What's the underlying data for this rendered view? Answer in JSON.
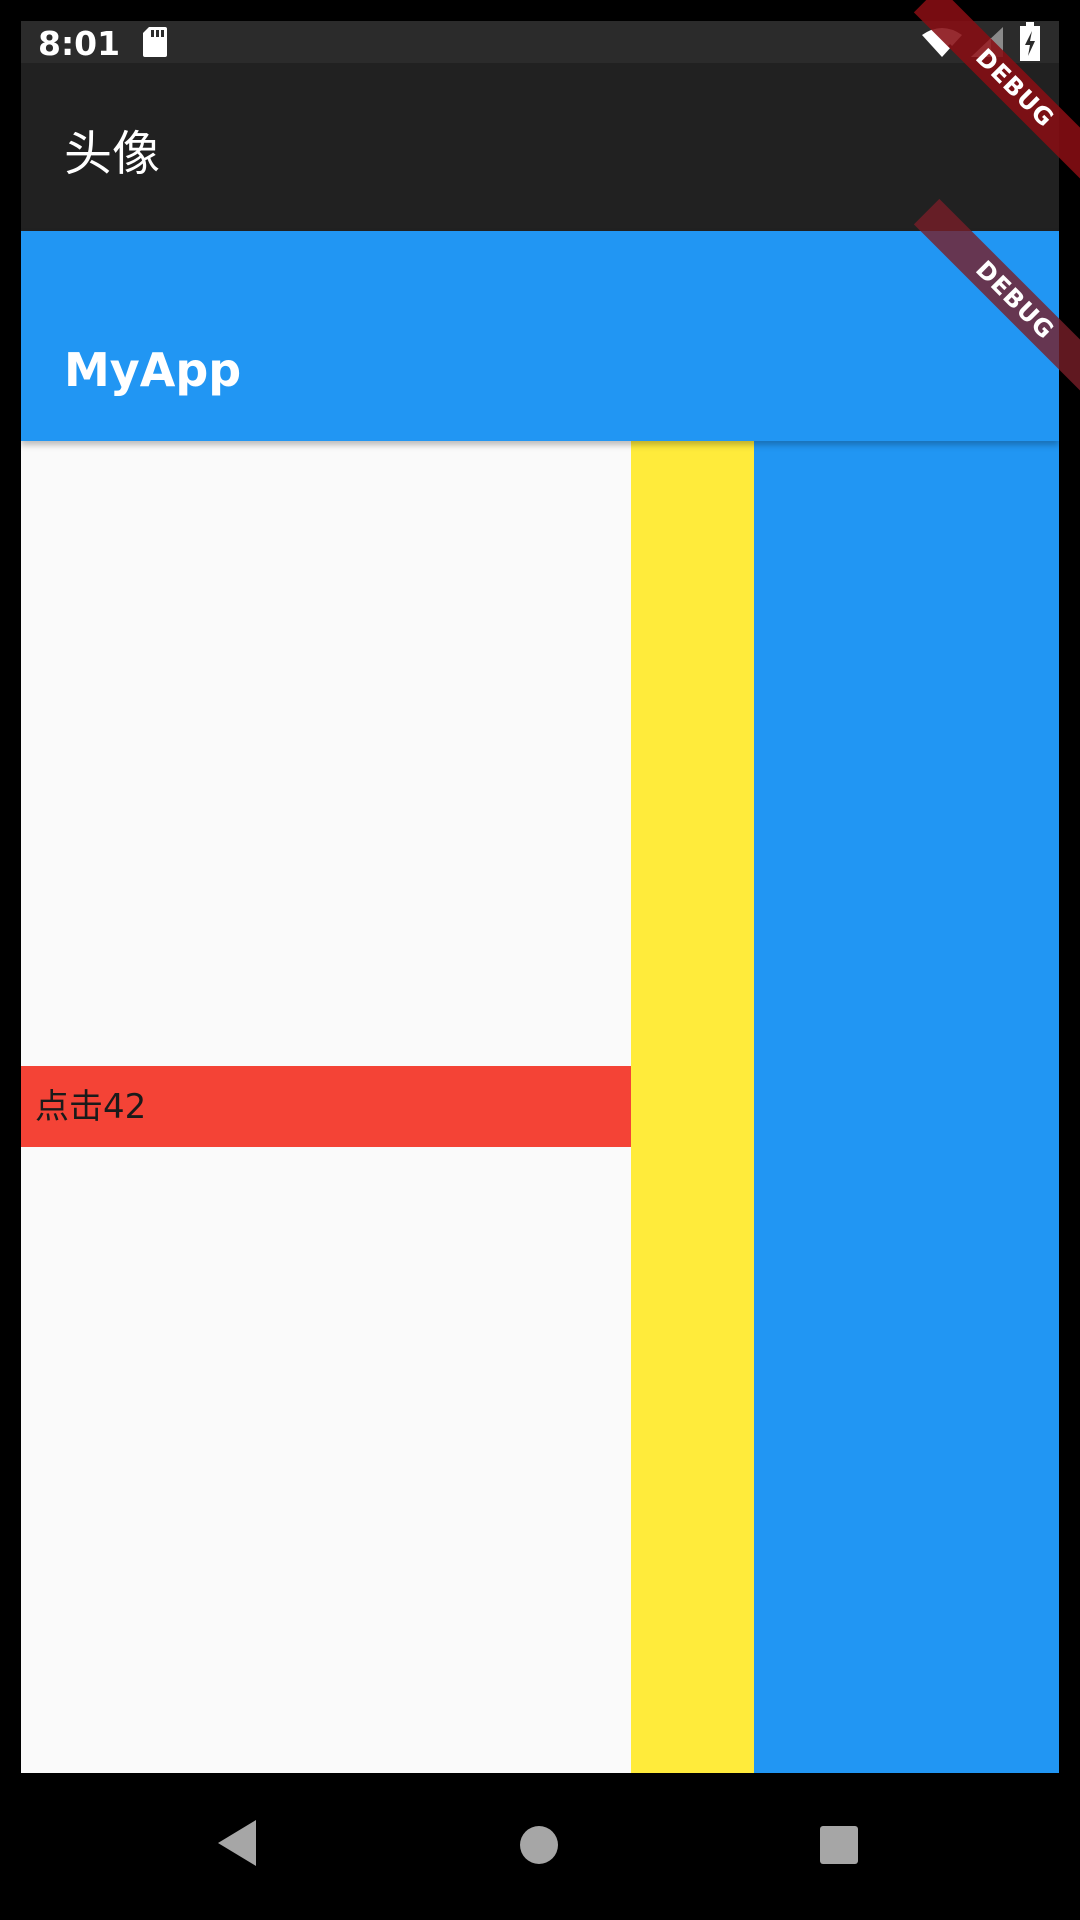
{
  "status_bar": {
    "time": "8:01",
    "icons": [
      "sd-card-icon",
      "wifi-icon",
      "signal-icon",
      "battery-charging-icon"
    ]
  },
  "appbar_dark": {
    "title": "头像",
    "background": "#212121"
  },
  "appbar_blue": {
    "title": "MyApp",
    "background": "#2196f3"
  },
  "debug_banner": {
    "label": "DEBUG"
  },
  "body": {
    "button_label": "点击42",
    "colors": {
      "background": "#fafafa",
      "button": "#f44336",
      "yellow": "#ffeb3b",
      "blue": "#2196f3"
    }
  },
  "nav_bar": {
    "icons": [
      "back-icon",
      "home-icon",
      "recents-icon"
    ]
  }
}
